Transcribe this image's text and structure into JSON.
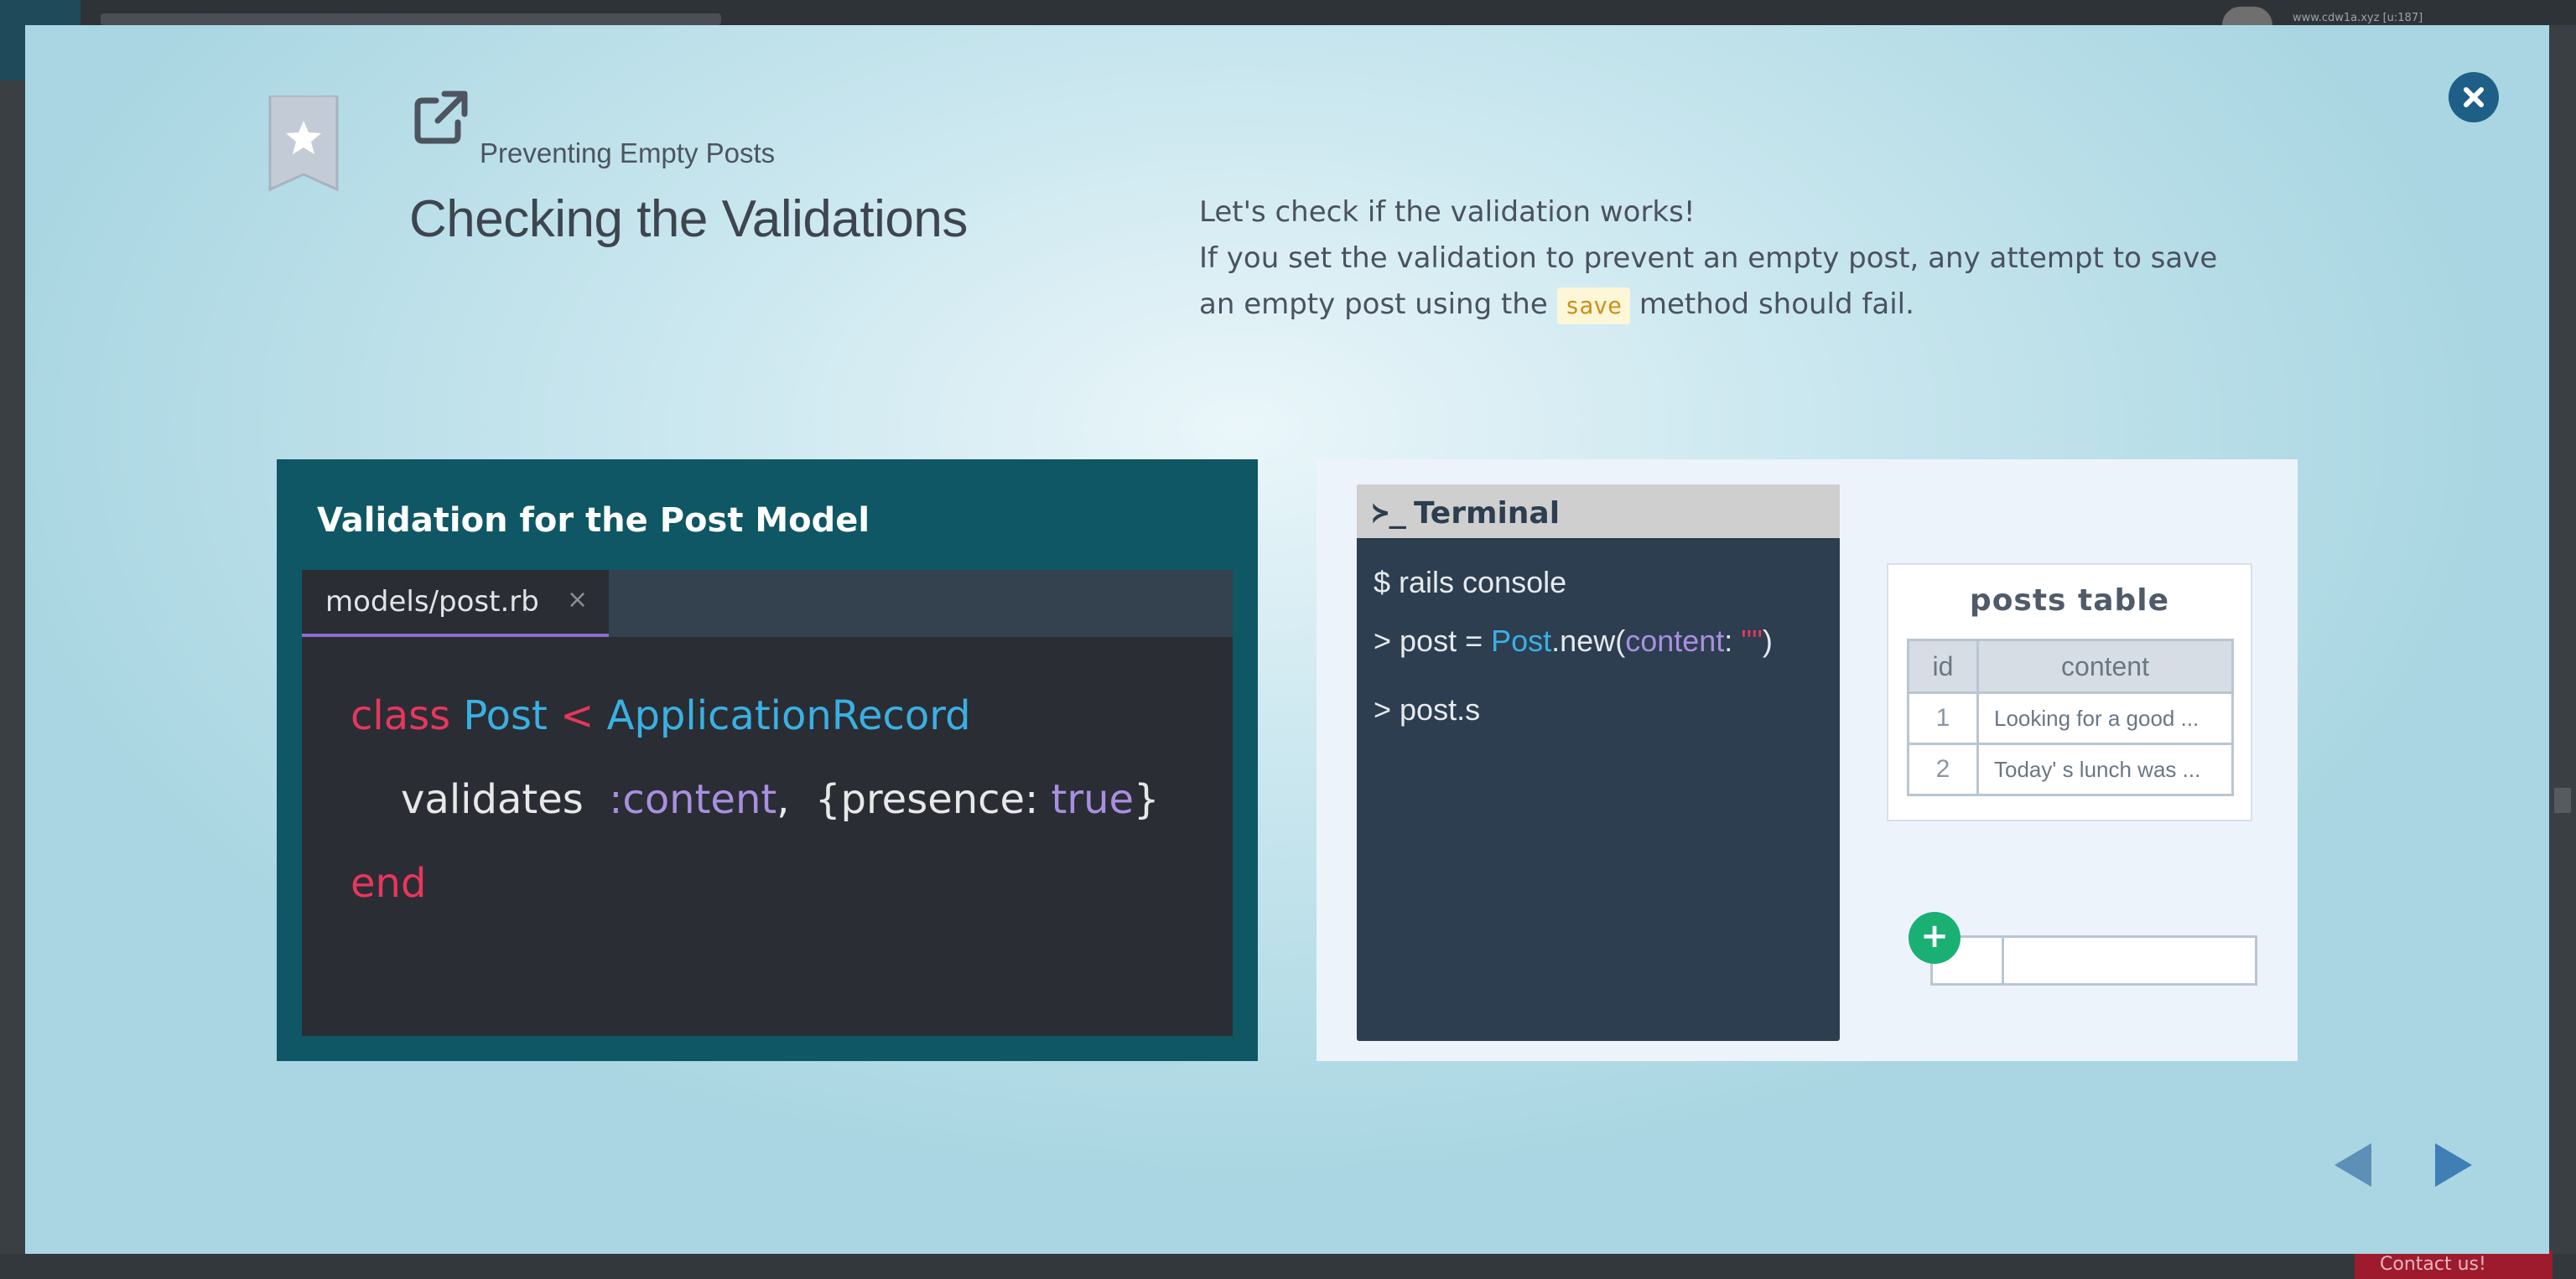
{
  "background": {
    "url_text": "www.cdw1a.xyz [u:187]",
    "contact_label": "Contact us!"
  },
  "lesson": {
    "subtitle": "Preventing Empty Posts",
    "title": "Checking the Validations"
  },
  "description": {
    "line1": "Let's check if the validation works!",
    "line2": "If you set the validation to prevent an empty post, any attempt to save",
    "line3_before": "an empty post using the",
    "line3_code": "save",
    "line3_after": "method should fail."
  },
  "code_panel": {
    "title": "Validation for the Post Model",
    "file_tab": "models/post.rb",
    "tab_close": "×",
    "line1": {
      "kw": "class",
      "cls": "Post",
      "op": "<",
      "parent": "ApplicationRecord"
    },
    "line2": {
      "method": "validates",
      "sym": ":content",
      "comma": ",",
      "open": "{presence:",
      "val": "true",
      "close": "}"
    },
    "line3": {
      "kw": "end"
    }
  },
  "terminal": {
    "title": "Terminal",
    "prompt_icon": "≻_",
    "line1": "$ rails console",
    "line2": {
      "prefix": "> post = ",
      "cls": "Post",
      "method": ".new(",
      "key": "content",
      "colon": ": ",
      "str": "\"\"",
      "close": ")"
    },
    "line3": "> post.s"
  },
  "posts_table": {
    "title": "posts table",
    "columns": [
      "id",
      "content"
    ],
    "rows": [
      {
        "id": "1",
        "content": "Looking for a good ..."
      },
      {
        "id": "2",
        "content": "Today' s lunch was ..."
      }
    ],
    "add_label": "+"
  },
  "colors": {
    "accent": "#1d5f86",
    "code_panel_bg": "#0f5764",
    "keyword": "#e8365d",
    "constant": "#3ab0e2",
    "symbol": "#a98fe0",
    "add_button": "#1ab074"
  }
}
